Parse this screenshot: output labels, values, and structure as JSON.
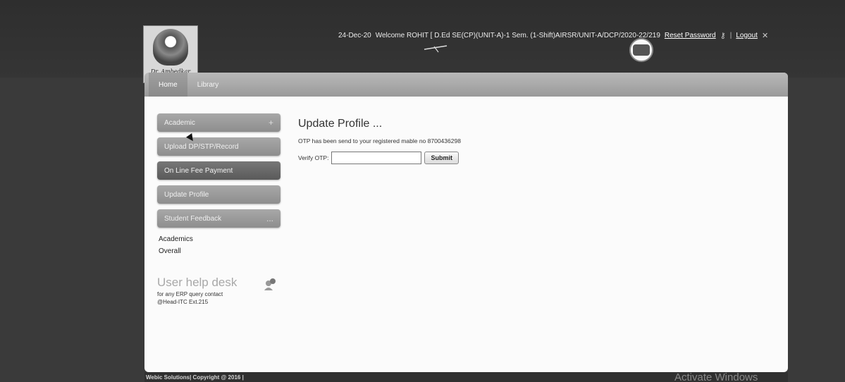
{
  "header": {
    "date": "24-Dec-20",
    "welcome_text": "Welcome ROHIT [ D.Ed SE(CP)(UNIT-A)-1 Sem. (1-Shift)AIRSR/UNIT-A/DCP/2020-22/219",
    "reset_password_label": "Reset Password",
    "separator": "|",
    "logout_label": "Logout",
    "logo_caption": "Dr. Ambedkar",
    "icons": [
      "key-icon",
      "close-icon"
    ]
  },
  "navbar": {
    "items": [
      {
        "label": "Home"
      },
      {
        "label": "Library"
      }
    ]
  },
  "sidebar": {
    "items": [
      {
        "label": "Academic",
        "suffix": "+"
      },
      {
        "label": "Upload DP/STP/Record",
        "suffix": ""
      },
      {
        "label": "On Line Fee Payment",
        "suffix": ""
      },
      {
        "label": "Update Profile",
        "suffix": ""
      },
      {
        "label": "Student Feedback",
        "suffix": "..."
      }
    ],
    "sub_items": [
      {
        "label": "Academics"
      },
      {
        "label": "Overall"
      }
    ],
    "helpdesk": {
      "title": "User help desk",
      "line1": "for any ERP query contact",
      "line2": "@Head-ITC Ext.215"
    }
  },
  "main": {
    "heading": "Update Profile ...",
    "message": "OTP has been send to your registered mable no 8700436298",
    "otp_label": "Verify OTP:",
    "otp_value": "",
    "submit_label": "Submit"
  },
  "footer": {
    "text": "Webic Solutions| Copyright @ 2016 |"
  },
  "watermark": {
    "text": "Activate Windows"
  },
  "colors": {
    "panel_bg": "#fbfbfb",
    "sidebar_button": "#9a9a9a",
    "page_bg": "#3a3a3a"
  }
}
